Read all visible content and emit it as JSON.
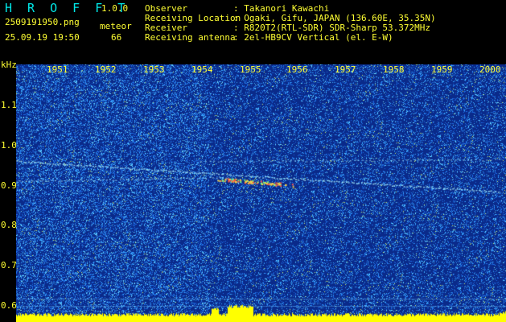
{
  "header": {
    "app_title": "H R O F F T",
    "version": "1.0.0",
    "filename": "2509191950.png",
    "datetime": "25.09.19 19:50",
    "mode_label": "meteor",
    "count": "66",
    "info": [
      {
        "key": "Observer",
        "value": ": Takanori Kawachi"
      },
      {
        "key": "Receiving Location",
        "value": ": Ogaki, Gifu, JAPAN (136.60E, 35.35N)"
      },
      {
        "key": "Receiver",
        "value": ": R820T2(RTL-SDR) SDR-Sharp 53.372MHz"
      },
      {
        "key": "Receiving antenna",
        "value": ": 2el-HB9CV Vertical (el. E-W)"
      }
    ]
  },
  "spectrogram": {
    "y_unit": "kHz",
    "y_ticks": [
      "1.1",
      "1.0",
      "0.9",
      "0.8",
      "0.7",
      "0.6"
    ],
    "x_ticks": [
      "1951",
      "1952",
      "1953",
      "1954",
      "1955",
      "1956",
      "1957",
      "1958",
      "1959",
      "2000"
    ],
    "colors": {
      "background": "#0a2a8a",
      "noise": "#3aa0ff",
      "signal": "#ffff00",
      "label": "#ffff33"
    }
  }
}
